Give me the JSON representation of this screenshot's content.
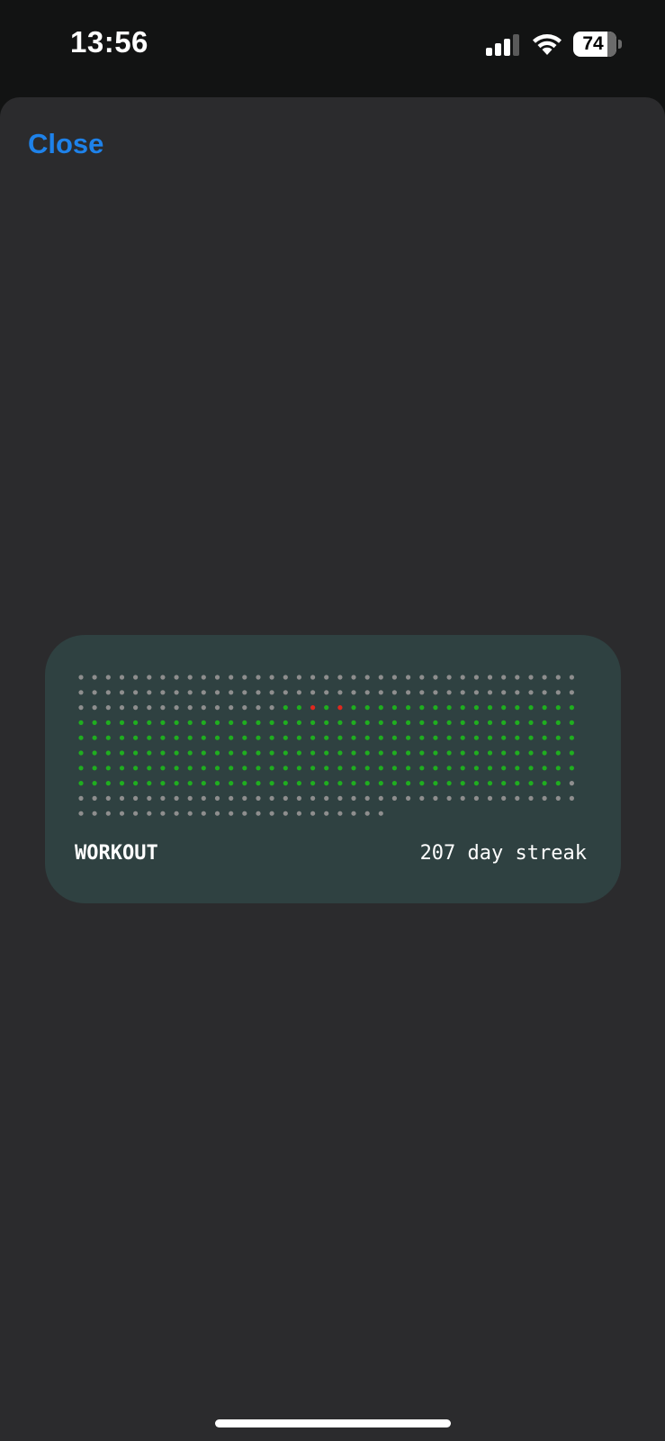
{
  "status_bar": {
    "time": "13:56",
    "battery_level": "74",
    "signal_icon": "cellular-signal-icon",
    "wifi_icon": "wifi-icon",
    "battery_icon": "battery-icon"
  },
  "sheet": {
    "close_label": "Close"
  },
  "widget": {
    "title": "WORKOUT",
    "streak": "207 day streak",
    "grid": {
      "columns": 37,
      "rows": 10,
      "last_row_count": 23,
      "colors": {
        "inactive": "#8e8e8e",
        "done": "#1fae1f",
        "missed": "#e0281e"
      },
      "rows_spec": [
        {
          "inactive": 37
        },
        {
          "inactive": 37
        },
        {
          "inactive": 15,
          "done": 1,
          "missed_pattern": "m d m d m",
          "rest_done": true
        },
        {
          "done": 37
        },
        {
          "done": 37
        },
        {
          "done": 37
        },
        {
          "done": 37
        },
        {
          "done": 36,
          "inactive_tail": 1
        },
        {
          "inactive": 37
        },
        {
          "inactive": 23
        }
      ]
    }
  },
  "theme": {
    "background": "#121313",
    "sheet": "#2b2b2d",
    "card": "#2f4141",
    "accent": "#1e82ea"
  }
}
